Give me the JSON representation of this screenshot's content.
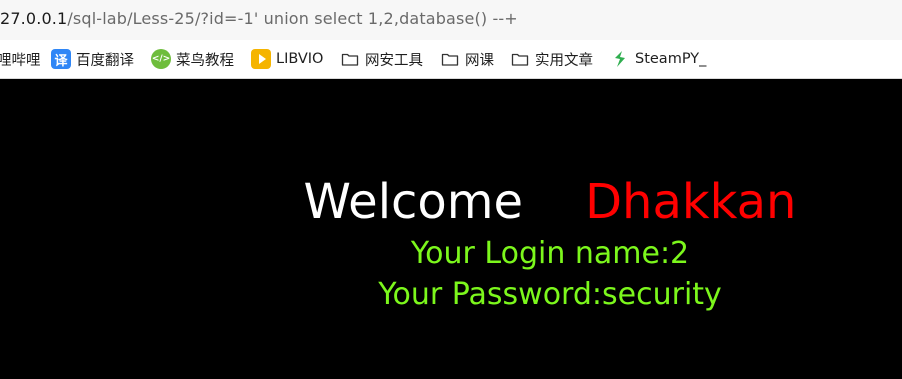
{
  "address_bar": {
    "url_host": "27.0.0.1",
    "url_path": "/sql-lab/Less-25/?id=-1' union select 1,2,database() --+"
  },
  "bookmarks": {
    "items": [
      {
        "label": "哩哔哩",
        "icon": "none"
      },
      {
        "label": "百度翻译",
        "icon": "baidu-translate-icon",
        "glyph": "译"
      },
      {
        "label": "菜鸟教程",
        "icon": "runoob-icon",
        "glyph": "</>"
      },
      {
        "label": "LIBVIO",
        "icon": "libvio-play-icon"
      },
      {
        "label": "网安工具",
        "icon": "folder-icon"
      },
      {
        "label": "网课",
        "icon": "folder-icon"
      },
      {
        "label": "实用文章",
        "icon": "folder-icon"
      },
      {
        "label": "SteamPY_",
        "icon": "steampy-icon"
      }
    ]
  },
  "page": {
    "welcome_text": "Welcome",
    "name_text": "Dhakkan",
    "login_line": "Your Login name:2",
    "password_line": "Your Password:security"
  },
  "colors": {
    "background": "#000000",
    "welcome": "#ffffff",
    "name": "#ff0000",
    "info": "#7cf71c"
  }
}
